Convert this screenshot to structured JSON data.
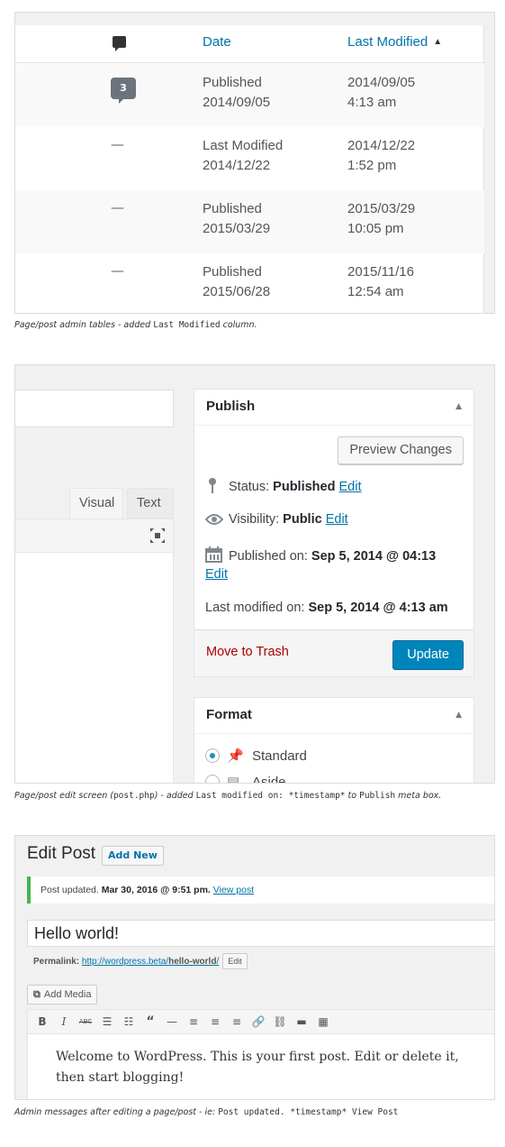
{
  "section1": {
    "table": {
      "columns": {
        "comments_icon": "comment-icon",
        "date": "Date",
        "last_modified": "Last Modified",
        "sort_indicator": "▲"
      },
      "rows": [
        {
          "comments": "3",
          "date_status": "Published",
          "date_value": "2014/09/05",
          "modified_date": "2014/09/05",
          "modified_time": "4:13 am"
        },
        {
          "comments": "—",
          "date_status": "Last Modified",
          "date_value": "2014/12/22",
          "modified_date": "2014/12/22",
          "modified_time": "1:52 pm"
        },
        {
          "comments": "—",
          "date_status": "Published",
          "date_value": "2015/03/29",
          "modified_date": "2015/03/29",
          "modified_time": "10:05 pm"
        },
        {
          "comments": "—",
          "date_status": "Published",
          "date_value": "2015/06/28",
          "modified_date": "2015/11/16",
          "modified_time": "12:54 am"
        }
      ]
    },
    "caption": {
      "part1": "Page/post admin tables - added ",
      "code1": "Last Modified",
      "part2": " column."
    }
  },
  "section2": {
    "editor_tabs": {
      "visual": "Visual",
      "text": "Text"
    },
    "publish_box": {
      "title": "Publish",
      "toggle": "▲",
      "preview_button": "Preview Changes",
      "status_label": "Status: ",
      "status_value": "Published",
      "visibility_label": "Visibility: ",
      "visibility_value": "Public",
      "published_label": "Published on: ",
      "published_value": "Sep 5, 2014 @ 04:13",
      "edit_link": "Edit",
      "last_modified_label": "Last modified on: ",
      "last_modified_value": "Sep 5, 2014 @ 4:13 am",
      "trash_link": "Move to Trash",
      "update_button": "Update"
    },
    "format_box": {
      "title": "Format",
      "toggle": "▲",
      "options": [
        {
          "label": "Standard",
          "selected": true
        },
        {
          "label": "Aside",
          "selected": false
        }
      ]
    },
    "caption": {
      "part1": "Page/post edit screen (",
      "code1": "post.php",
      "part2": ") - added ",
      "code2": "Last modified on: *timestamp*",
      "part3": " to ",
      "code3": "Publish",
      "part4": " meta box."
    }
  },
  "section3": {
    "page_title": "Edit Post",
    "add_new_button": "Add New",
    "notice": {
      "prefix": "Post updated. ",
      "timestamp": "Mar 30, 2016 @ 9:51 pm.",
      "link": "View post",
      "accent": "#46b450"
    },
    "post_title_value": "Hello world!",
    "permalink": {
      "label": "Permalink:",
      "url_base": "http://wordpress.beta/",
      "slug": "hello-world",
      "url_end": "/",
      "edit_button": "Edit"
    },
    "add_media_button": "Add Media",
    "toolbar": [
      "bold",
      "italic",
      "strikethrough",
      "bullet-list",
      "numbered-list",
      "blockquote",
      "horizontal-rule",
      "align-left",
      "align-center",
      "align-right",
      "link",
      "unlink",
      "read-more",
      "toolbar-toggle"
    ],
    "content": "Welcome to WordPress. This is your first post. Edit or delete it, then start blogging!",
    "caption": {
      "part1": "Admin messages after editing a page/post - ie: ",
      "code1": "Post updated. *timestamp* View Post"
    }
  },
  "colors": {
    "link": "#0073aa",
    "primary_button": "#0085ba",
    "trash": "#aa0000",
    "success": "#46b450"
  }
}
